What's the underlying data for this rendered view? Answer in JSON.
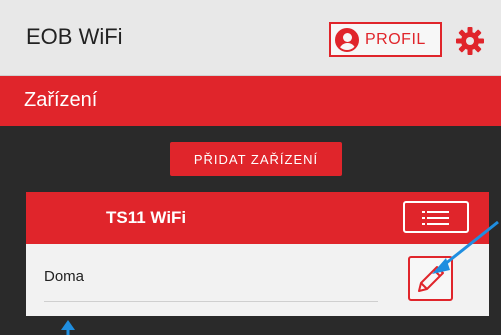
{
  "header": {
    "title": "EOB WiFi",
    "profile_label": "PROFIL"
  },
  "section": {
    "title": "Zařízení"
  },
  "actions": {
    "add_device_label": "PŘIDAT ZAŘÍZENÍ"
  },
  "device": {
    "name": "TS11 WiFi",
    "location": "Doma"
  },
  "icons": {
    "profile": "user-circle-icon",
    "settings": "gear-icon",
    "menu": "list-icon",
    "edit": "pencil-icon"
  },
  "colors": {
    "accent": "#e0252b",
    "background": "#2a2a2a",
    "header": "#e8e8e8",
    "annotation": "#1f8ee0"
  }
}
